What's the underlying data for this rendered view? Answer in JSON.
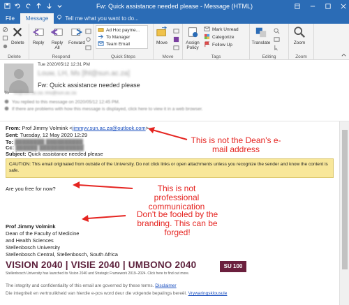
{
  "window": {
    "title": "Fw: Quick assistance needed please  -  Message (HTML)"
  },
  "tabs": {
    "file": "File",
    "message": "Message",
    "tell_me": "Tell me what you want to do..."
  },
  "ribbon": {
    "delete_group": {
      "label": "Delete",
      "delete": "Delete"
    },
    "respond_group": {
      "label": "Respond",
      "reply": "Reply",
      "reply_all": "Reply All",
      "forward": "Forward"
    },
    "quick_steps": {
      "label": "Quick Steps",
      "items": [
        "Ad Hoc payme...",
        "To Manager",
        "Team Email"
      ]
    },
    "move_group": {
      "label": "Move",
      "move": "Move"
    },
    "policy": {
      "assign": "Assign Policy"
    },
    "tags_group": {
      "label": "Tags",
      "mark_unread": "Mark Unread",
      "categorize": "Categorize",
      "follow_up": "Follow Up"
    },
    "editing_group": {
      "label": "Editing",
      "translate": "Translate"
    },
    "zoom_group": {
      "label": "Zoom",
      "zoom": "Zoom"
    }
  },
  "header": {
    "date": "Tue 2020/05/12 12:31 PM",
    "sender_blurred": "Louw, LH, Ms [lhl@sun.ac.za]",
    "subject": "Fw: Quick assistance needed please",
    "to_label": "To",
    "to_value_blurred": "lhl@sun.ac.za; ims@sun.ac.za",
    "info_line_1": "You replied to this message on 2020/05/12 12:45 PM.",
    "info_line_2": "If there are problems with how this message is displayed, click here to view it in a web browser."
  },
  "body": {
    "from_label": "From:",
    "from_name": "Prof Jimmy Volmink <",
    "from_email": "jimmyv.sun.ac.za@outlook.com",
    "from_close": ">",
    "sent_label": "Sent:",
    "sent_value": "Tuesday, 12 May 2020 12:29",
    "to_label": "To:",
    "cc_label": "Cc:",
    "subject_label": "Subject:",
    "subject_value": "Quick assistance needed please",
    "caution": "CAUTION: This email originated from outside of the University. Do not click links or open attachments unless you recognize the sender and know the content is safe.",
    "question": "Are you free for now?",
    "sig_name": "Prof Jimmy Volmink",
    "sig_line1": "Dean of the Faculty of Medicine",
    "sig_line2": "and Health Sciences",
    "sig_line3": "Stellenbosch University",
    "sig_line4": "Stellenbosch Central, Stellenbosch, South Africa",
    "vision_banner": "VISION 2040 | VISIE 2040 | UMBONO 2040",
    "vision_sub": "Stellenbosch University has launched its Vision 2040 and Strategic Framework 2019–2024. Click here to find out more.",
    "badge": "SU 100",
    "disclaimer_1": "The integrity and confidentiality of this email are governed by these terms. ",
    "disclaimer_1_link": "Disclaimer",
    "disclaimer_2": "Die integriteit en vertroulikheid van hierdie e-pos word deur die volgende bepalings bereël. ",
    "disclaimer_2_link": "Vrywaringsklousule"
  },
  "annotations": {
    "note1": "This is not the Dean's e-mail address",
    "note2": "This is not professional communication",
    "note3": "Don't be fooled by the branding. This can be forged!"
  },
  "colors": {
    "outlook_blue": "#2b6cb6",
    "annotation_red": "#e52420",
    "caution_yellow": "#f8e79a",
    "vision_maroon": "#5b1f3a"
  }
}
